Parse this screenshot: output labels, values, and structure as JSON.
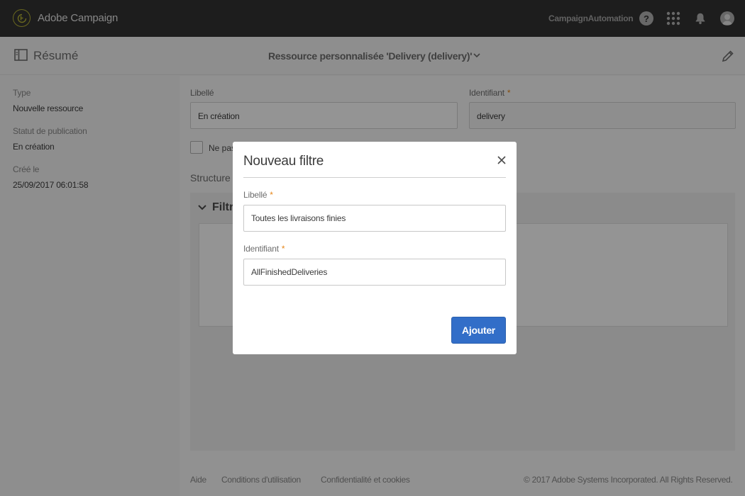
{
  "topbar": {
    "app_name": "Adobe Campaign",
    "org_name": "CampaignAutomation",
    "help_glyph": "?",
    "icons": [
      "adobe-campaign-logo-icon",
      "help-icon",
      "apps-grid-icon",
      "bell-icon",
      "avatar-icon"
    ]
  },
  "header": {
    "summary_label": "Résumé",
    "resource_title": "Ressource personnalisée 'Delivery (delivery)'",
    "icons": [
      "summary-panel-icon",
      "chevron-down-icon",
      "pencil-edit-icon"
    ]
  },
  "sidebar": {
    "type_label": "Type",
    "type_value": "Nouvelle ressource",
    "status_label": "Statut de publication",
    "status_value": "En création",
    "created_label": "Créé le",
    "created_value": "25/09/2017 06:01:58"
  },
  "main": {
    "libelle_label": "Libellé",
    "libelle_value": "En création",
    "identifiant_label": "Identifiant",
    "identifiant_value": "delivery",
    "required_marker": "*",
    "checkbox_label": "Ne pas",
    "structure_title": "Structure d",
    "filter_section_title": "Filtr"
  },
  "footer": {
    "help": "Aide",
    "terms": "Conditions d'utilisation",
    "privacy": "Confidentialité et cookies",
    "copyright": "© 2017 Adobe Systems Incorporated. All Rights Reserved."
  },
  "dialog": {
    "title": "Nouveau filtre",
    "label_field_label": "Libellé",
    "label_field_value": "Toutes les livraisons finies",
    "id_field_label": "Identifiant",
    "id_field_value": "AllFinishedDeliveries",
    "required_marker": "*",
    "add_button": "Ajouter"
  },
  "colors": {
    "topbar": "#323232",
    "accent_blue": "#326ec8",
    "required_orange": "#e68619",
    "logo_yellow": "#b6b335"
  }
}
